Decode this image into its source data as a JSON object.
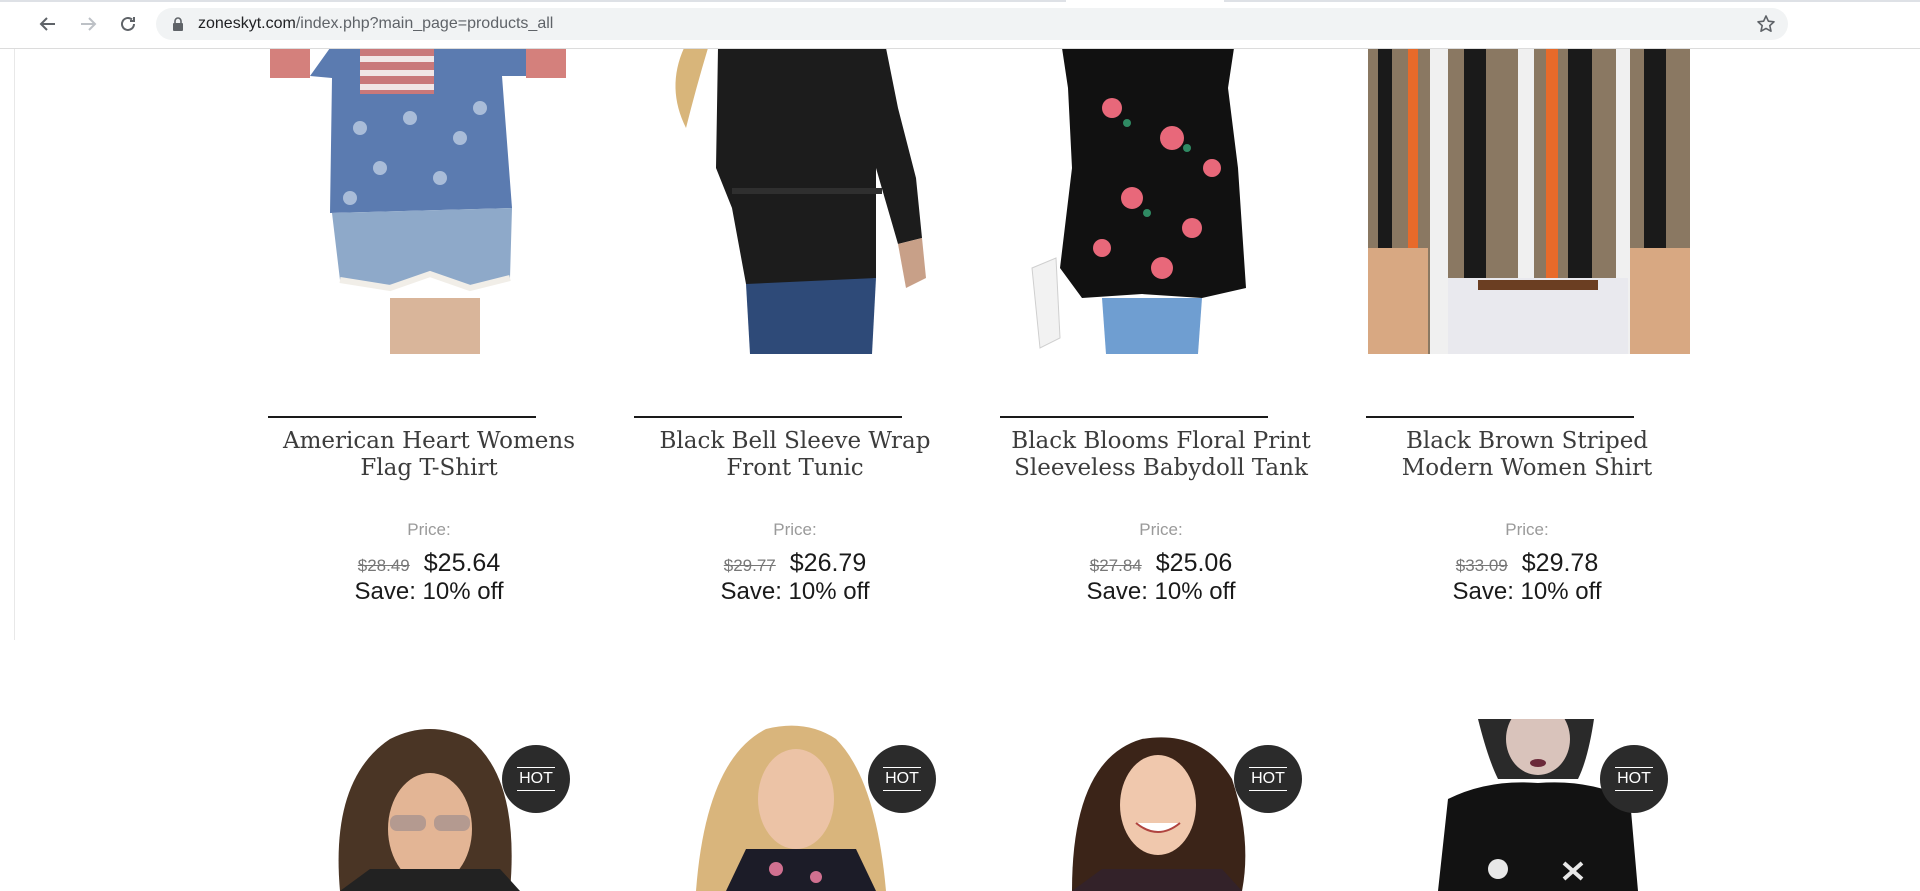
{
  "browser": {
    "url_host": "zoneskyt.com",
    "url_path": "/index.php?main_page=products_all"
  },
  "products": [
    {
      "name": "American Heart Womens Flag T-Shirt",
      "price_label": "Price:",
      "old_price": "$28.49",
      "new_price": "$25.64",
      "save": "Save: 10% off"
    },
    {
      "name": "Black Bell Sleeve Wrap Front Tunic",
      "price_label": "Price:",
      "old_price": "$29.77",
      "new_price": "$26.79",
      "save": "Save: 10% off"
    },
    {
      "name": "Black Blooms Floral Print Sleeveless Babydoll Tank",
      "price_label": "Price:",
      "old_price": "$27.84",
      "new_price": "$25.06",
      "save": "Save: 10% off"
    },
    {
      "name": "Black Brown Striped Modern Women Shirt",
      "price_label": "Price:",
      "old_price": "$33.09",
      "new_price": "$29.78",
      "save": "Save: 10% off"
    }
  ],
  "hot_badges": [
    "HOT",
    "HOT",
    "HOT",
    "HOT"
  ]
}
